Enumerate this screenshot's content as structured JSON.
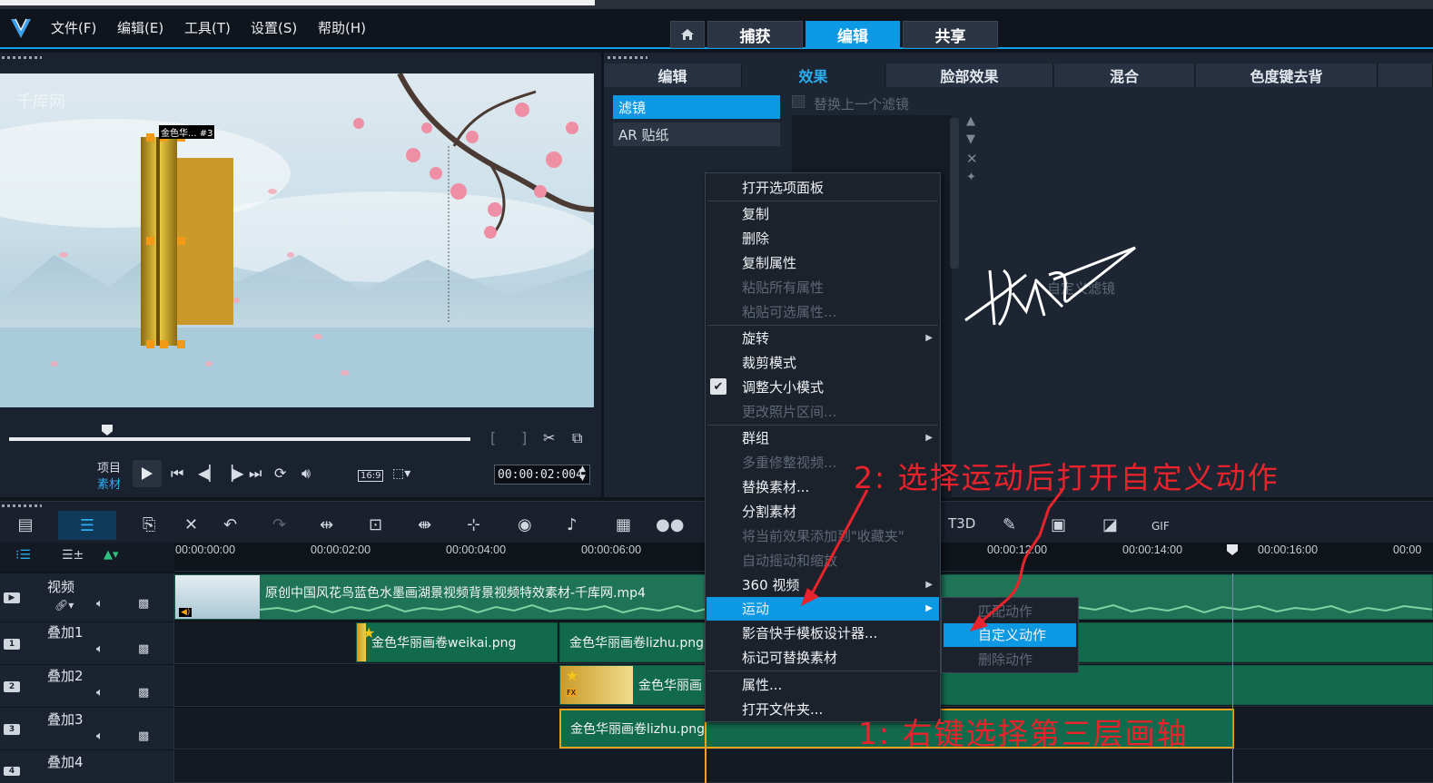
{
  "menu": {
    "file": "文件(F)",
    "edit": "编辑(E)",
    "tools": "工具(T)",
    "settings": "设置(S)",
    "help": "帮助(H)"
  },
  "workspace_tabs": {
    "capture": "捕获",
    "edit": "编辑",
    "share": "共享"
  },
  "preview": {
    "watermark": "千库网",
    "object_label": "金色华... #3",
    "project_label": "项目",
    "clip_label": "素材",
    "aspect": "16:9",
    "timecode": "00:00:02:004",
    "scrub_progress": 0.21
  },
  "options_tabs": [
    "编辑",
    "效果",
    "脸部效果",
    "混合",
    "色度键去背"
  ],
  "options": {
    "categories": [
      "滤镜",
      "AR 贴纸"
    ],
    "replace_filter": "替换上一个滤镜",
    "custom_filter": "自定义滤镜"
  },
  "ruler": [
    "00:00:00:00",
    "00:00:02:00",
    "00:00:04:00",
    "00:00:06:00",
    "00:00:12:00",
    "00:00:14:00",
    "00:00:16:00",
    "00:00"
  ],
  "tracks": [
    {
      "name": "视频",
      "num": ""
    },
    {
      "name": "叠加1",
      "num": "1"
    },
    {
      "name": "叠加2",
      "num": "2"
    },
    {
      "name": "叠加3",
      "num": "3"
    },
    {
      "name": "叠加4",
      "num": "4"
    }
  ],
  "clips": {
    "video": "原创中国风花鸟蓝色水墨画湖景视频背景视频特效素材-千库网.mp4",
    "ov1a": "金色华丽画卷weikai.png",
    "ov1b": "金色华丽画卷lizhu.png",
    "ov2": "金色华丽画",
    "ov3": "金色华丽画卷lizhu.png"
  },
  "context_menu": {
    "open_panel": "打开选项面板",
    "copy": "复制",
    "delete": "删除",
    "copy_attr": "复制属性",
    "paste_all": "粘贴所有属性",
    "paste_sel": "粘贴可选属性...",
    "rotate": "旋转",
    "crop": "裁剪模式",
    "resize": "调整大小模式",
    "photo_range": "更改照片区间...",
    "group": "群组",
    "multitrim": "多重修整视频...",
    "replace": "替换素材...",
    "split": "分割素材",
    "add_fav": "将当前效果添加到\"收藏夹\"",
    "panzoom": "自动摇动和缩放",
    "video360": "360 视频",
    "motion": "运动",
    "template": "影音快手模板设计器...",
    "mark_replace": "标记可替换素材",
    "properties": "属性...",
    "open_folder": "打开文件夹..."
  },
  "submenu": {
    "match": "匹配动作",
    "custom": "自定义动作",
    "remove": "删除动作"
  },
  "annotations": {
    "step2": "2:  选择运动后打开自定义动作",
    "step1": "1:  右键选择第三层画轴"
  }
}
